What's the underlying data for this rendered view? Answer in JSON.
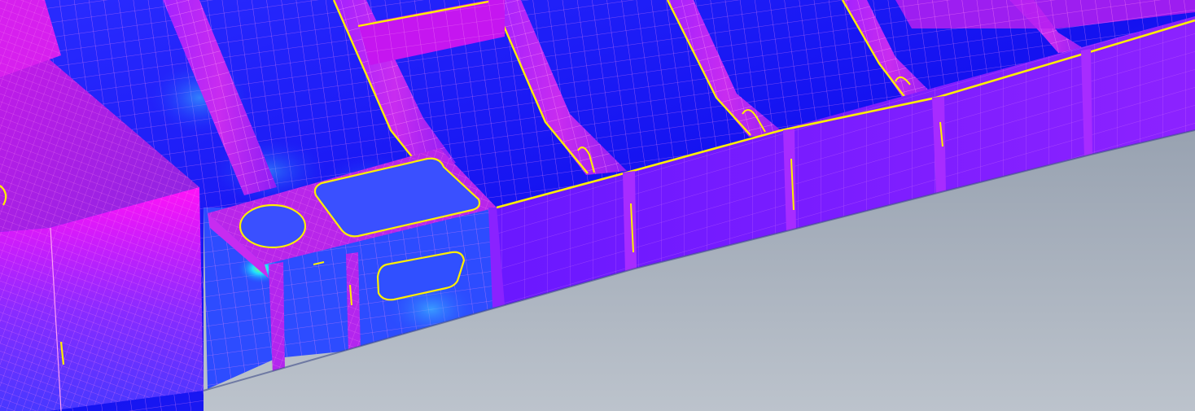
{
  "viewport": {
    "background_gradient": [
      "#98a2b1",
      "#b9c1cb"
    ],
    "mesh_color": "#ff8ff2",
    "edge_color": "#ffee00",
    "contour_palette": {
      "low": "#1a1aff",
      "mid_low": "#3a49ff",
      "mid": "#8a1cff",
      "high": "#cc2cff",
      "peak": "#ff10f4",
      "hot_spot": "#20d8ff",
      "hot_spot_peak": "#8cff60"
    }
  }
}
